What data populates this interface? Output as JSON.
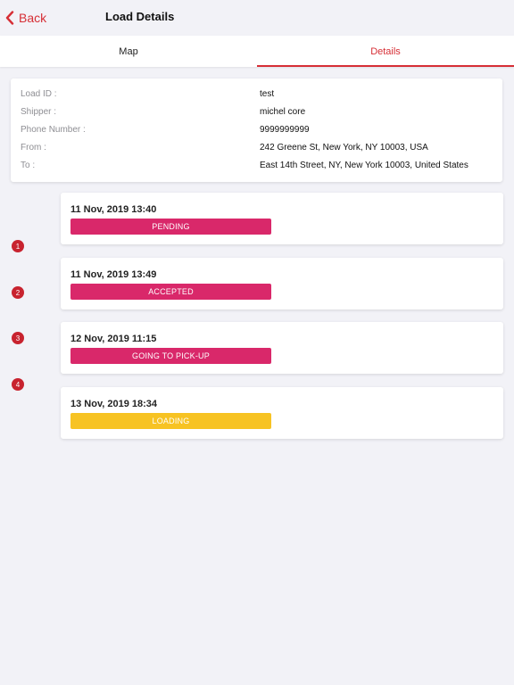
{
  "nav": {
    "back_label": "Back",
    "title": "Load Details"
  },
  "tabs": [
    {
      "label": "Map",
      "active": false
    },
    {
      "label": "Details",
      "active": true
    }
  ],
  "details": [
    {
      "label": "Load ID :",
      "value": "test"
    },
    {
      "label": "Shipper :",
      "value": "michel core"
    },
    {
      "label": "Phone Number :",
      "value": "9999999999"
    },
    {
      "label": "From :",
      "value": "242 Greene St, New York, NY 10003, USA"
    },
    {
      "label": "To :",
      "value": "East 14th Street, NY, New York 10003, United States"
    }
  ],
  "timeline": [
    {
      "step": "1",
      "date": "11 Nov, 2019 13:40",
      "status": "PENDING",
      "color": "#d9286a"
    },
    {
      "step": "2",
      "date": "11 Nov, 2019 13:49",
      "status": "ACCEPTED",
      "color": "#d9286a"
    },
    {
      "step": "3",
      "date": "12 Nov, 2019 11:15",
      "status": "GOING TO PICK-UP",
      "color": "#d9286a"
    },
    {
      "step": "4",
      "date": "13 Nov, 2019 18:34",
      "status": "LOADING",
      "color": "#f7c323"
    }
  ],
  "colors": {
    "accent": "#d62e35",
    "step_dot": "#c8232f"
  }
}
